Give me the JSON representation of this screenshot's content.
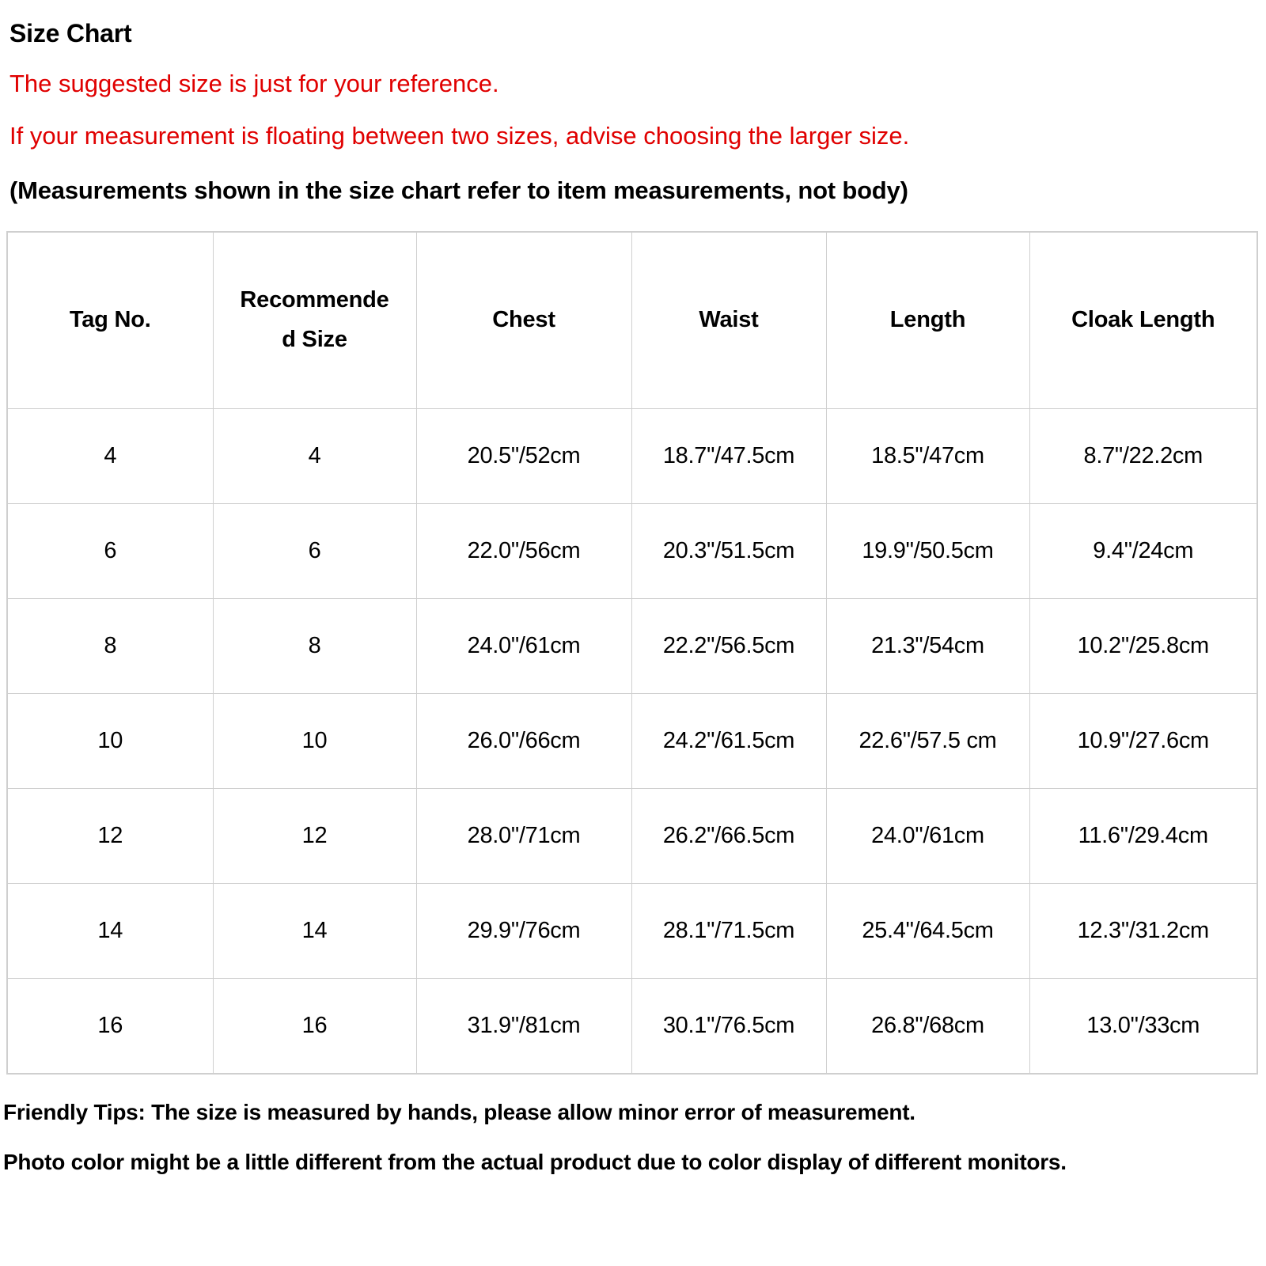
{
  "page": {
    "title": "Size Chart"
  },
  "notes": [
    {
      "text": "The suggested size is just for your reference.",
      "color": "#e00000",
      "bold": false
    },
    {
      "text": "If your measurement is floating between two sizes, advise choosing the larger size.",
      "color": "#e00000",
      "bold": false
    },
    {
      "text": "(Measurements shown in the size chart refer to item measurements, not body)",
      "color": "#000000",
      "bold": true
    }
  ],
  "chart_data": {
    "type": "table",
    "title": "Size Chart",
    "columns": [
      "Tag No.",
      "Recommended Size",
      "Chest",
      "Waist",
      "Length",
      "Cloak Length"
    ],
    "column_display": [
      "Tag No.",
      "Recommende d Size",
      "Chest",
      "Waist",
      "Length",
      "Cloak Length"
    ],
    "rows": [
      [
        "4",
        "4",
        "20.5\"/52cm",
        "18.7\"/47.5cm",
        "18.5\"/47cm",
        "8.7\"/22.2cm"
      ],
      [
        "6",
        "6",
        "22.0\"/56cm",
        "20.3\"/51.5cm",
        "19.9\"/50.5cm",
        "9.4\"/24cm"
      ],
      [
        "8",
        "8",
        "24.0\"/61cm",
        "22.2\"/56.5cm",
        "21.3\"/54cm",
        "10.2\"/25.8cm"
      ],
      [
        "10",
        "10",
        "26.0\"/66cm",
        "24.2\"/61.5cm",
        "22.6\"/57.5 cm",
        "10.9\"/27.6cm"
      ],
      [
        "12",
        "12",
        "28.0\"/71cm",
        "26.2\"/66.5cm",
        "24.0\"/61cm",
        "11.6\"/29.4cm"
      ],
      [
        "14",
        "14",
        "29.9\"/76cm",
        "28.1\"/71.5cm",
        "25.4\"/64.5cm",
        "12.3\"/31.2cm"
      ],
      [
        "16",
        "16",
        "31.9\"/81cm",
        "30.1\"/76.5cm",
        "26.8\"/68cm",
        "13.0\"/33cm"
      ]
    ]
  },
  "table": {
    "headers": {
      "tag_no": "Tag No.",
      "recommended_size_line1": "Recommende",
      "recommended_size_line2": "d Size",
      "chest": "Chest",
      "waist": "Waist",
      "length": "Length",
      "cloak_length": "Cloak Length"
    },
    "rows": [
      {
        "tag_no": "4",
        "recommended_size": "4",
        "chest": "20.5\"/52cm",
        "waist": "18.7\"/47.5cm",
        "length": "18.5\"/47cm",
        "cloak_length": "8.7\"/22.2cm"
      },
      {
        "tag_no": "6",
        "recommended_size": "6",
        "chest": "22.0\"/56cm",
        "waist": "20.3\"/51.5cm",
        "length": "19.9\"/50.5cm",
        "cloak_length": "9.4\"/24cm"
      },
      {
        "tag_no": "8",
        "recommended_size": "8",
        "chest": "24.0\"/61cm",
        "waist": "22.2\"/56.5cm",
        "length": "21.3\"/54cm",
        "cloak_length": "10.2\"/25.8cm"
      },
      {
        "tag_no": "10",
        "recommended_size": "10",
        "chest": "26.0\"/66cm",
        "waist": "24.2\"/61.5cm",
        "length": "22.6\"/57.5 cm",
        "cloak_length": "10.9\"/27.6cm"
      },
      {
        "tag_no": "12",
        "recommended_size": "12",
        "chest": "28.0\"/71cm",
        "waist": "26.2\"/66.5cm",
        "length": "24.0\"/61cm",
        "cloak_length": "11.6\"/29.4cm"
      },
      {
        "tag_no": "14",
        "recommended_size": "14",
        "chest": "29.9\"/76cm",
        "waist": "28.1\"/71.5cm",
        "length": "25.4\"/64.5cm",
        "cloak_length": "12.3\"/31.2cm"
      },
      {
        "tag_no": "16",
        "recommended_size": "16",
        "chest": "31.9\"/81cm",
        "waist": "30.1\"/76.5cm",
        "length": "26.8\"/68cm",
        "cloak_length": "13.0\"/33cm"
      }
    ]
  },
  "tips": [
    "Friendly Tips: The size is measured by hands, please allow minor error of measurement.",
    "Photo color might be a little different from the actual product due to color display of different monitors."
  ],
  "colors": {
    "note_red": "#e00000",
    "text_black": "#000000",
    "table_border": "#cfcfcf",
    "background": "#ffffff"
  }
}
